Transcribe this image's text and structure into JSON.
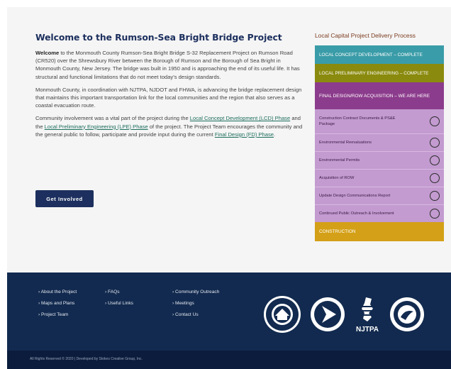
{
  "intro": {
    "title": "Welcome to the Rumson-Sea Bright Bridge Project",
    "p1_bold": "Welcome",
    "p1_rest": " to the Monmouth County Rumson-Sea Bright Bridge S-32 Replacement Project on Rumson Road (CR520) over the Shrewsbury River between the Borough of Rumson and the Borough of Sea Bright in Monmouth County, New Jersey. The bridge was built in 1950 and is approaching the end of its useful life. It has structural and functional limitations that do not meet today’s design standards.",
    "p2": "Monmouth County, in coordination with NJTPA, NJDOT and FHWA, is advancing the bridge replacement design that maintains this important transportation link for the local communities and the region that also serves as a coastal evacuation route.",
    "p3_a": "Community involvement was a vital part of the project during the ",
    "p3_link1": "Local Concept Development (LCD) Phase",
    "p3_b": " and the ",
    "p3_link2": "Local Preliminary Engineering (LPE) Phase",
    "p3_c": " of the project.  The Project Team  encourages the community and the general public to follow, participate and provide input during the current ",
    "p3_link3": "Final Design (FD) Phase",
    "p3_d": ".",
    "button": "Get Involved"
  },
  "process": {
    "title": "Local Capital Project Delivery Process",
    "lcd": "LOCAL CONCEPT DEVELOPMENT – COMPLETE",
    "lpe": "LOCAL PRELIMINARY ENGINEERING – COMPLETE",
    "fd": "FINAL DESIGN/ROW ACQUISITION – WE ARE HERE",
    "substeps": [
      "Construction Contract Documents & PS&E Package",
      "Environmental Reevaluations",
      "Environmental Permits",
      "Acquisition of ROW",
      "Update Design Communications Report",
      "Continued Public Outreach & Involvement"
    ],
    "construction": "CONSTRUCTION"
  },
  "footer": {
    "col1": [
      "› About the Project",
      "› Maps and Plans",
      "› Project Team"
    ],
    "col2": [
      "› FAQs",
      "› Useful Links"
    ],
    "col3": [
      "› Community Outreach",
      "› Meetings",
      "› Contact Us"
    ],
    "logos": {
      "county_seal": "COUNTY OF MONMOUTH NEW JERSEY",
      "njdot": "STATE OF NEW JERSEY",
      "njtpa": "NJTPA",
      "usdot": "DEPARTMENT OF TRANSPORTATION UNITED STATES OF AMERICA"
    },
    "copyright": "All Rights Reserved © 2020  |  Developed by Stokes Creative Group, Inc."
  },
  "colors": {
    "navy": "#1c2f5e",
    "lcd": "#3a9ca8",
    "lpe": "#8a8a0e",
    "fd": "#8c3c8c",
    "substeps": "#c39bd0",
    "construction": "#d4a017"
  }
}
